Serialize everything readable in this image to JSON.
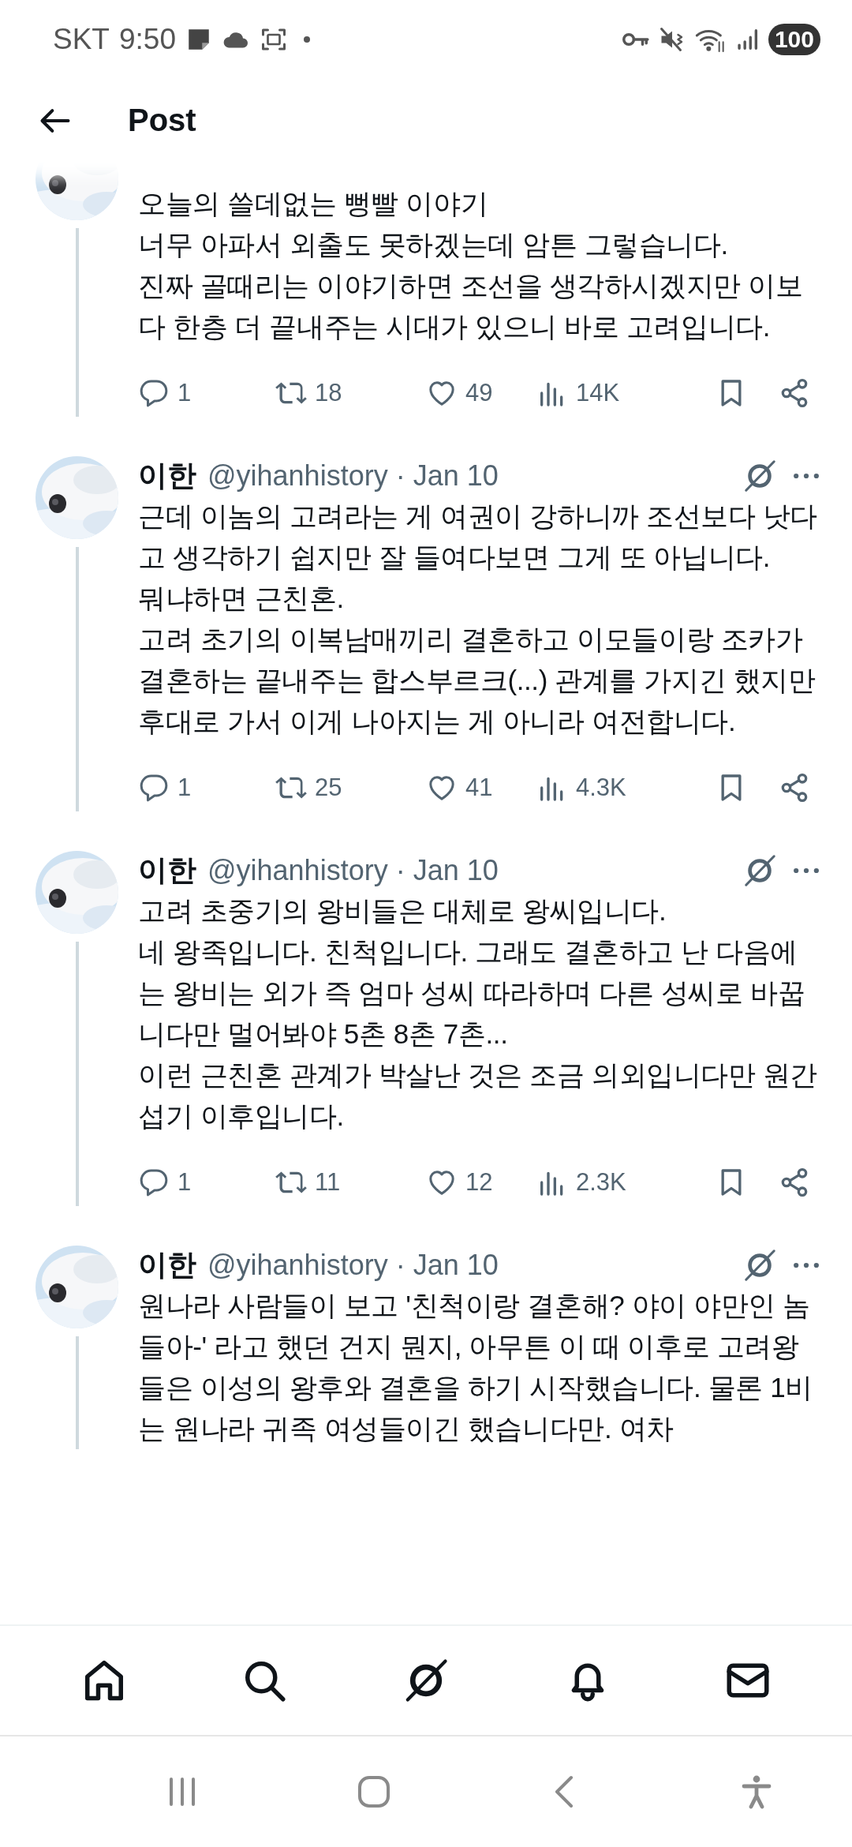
{
  "status_bar": {
    "carrier": "SKT",
    "time": "9:50",
    "battery": "100"
  },
  "header": {
    "title": "Post"
  },
  "tweets": [
    {
      "lines": [
        "오늘의 쓸데없는 뻥빨 이야기",
        "너무 아파서 외출도 못하겠는데 암튼 그렇습니다.",
        "진짜 골때리는 이야기하면 조선을 생각하시겠지만 이보다 한층 더 끝내주는 시대가 있으니 바로 고려입니다."
      ],
      "stats": {
        "replies": "1",
        "reposts": "18",
        "likes": "49",
        "views": "14K"
      }
    },
    {
      "name": "이한",
      "meta": "@yihanhistory · Jan 10",
      "lines": [
        "근데 이놈의 고려라는 게 여권이 강하니까 조선보다 낫다고 생각하기 쉽지만 잘 들여다보면 그게 또 아닙니다.",
        "뭐냐하면 근친혼.",
        "고려 초기의 이복남매끼리 결혼하고 이모들이랑 조카가 결혼하는 끝내주는 합스부르크(...) 관계를 가지긴 했지만 후대로 가서 이게 나아지는 게 아니라 여전합니다."
      ],
      "stats": {
        "replies": "1",
        "reposts": "25",
        "likes": "41",
        "views": "4.3K"
      }
    },
    {
      "name": "이한",
      "meta": "@yihanhistory · Jan 10",
      "lines": [
        "고려 초중기의 왕비들은 대체로 왕씨입니다.",
        "네 왕족입니다. 친척입니다. 그래도 결혼하고 난 다음에는 왕비는 외가 즉 엄마 성씨 따라하며 다른 성씨로 바꿉니다만 멀어봐야 5촌 8촌 7촌...",
        "이런 근친혼 관계가 박살난 것은 조금 의외입니다만 원간섭기 이후입니다."
      ],
      "stats": {
        "replies": "1",
        "reposts": "11",
        "likes": "12",
        "views": "2.3K"
      }
    },
    {
      "name": "이한",
      "meta": "@yihanhistory · Jan 10",
      "lines": [
        "원나라 사람들이 보고 '친척이랑 결혼해? 야이 야만인 놈들아-' 라고 했던 건지 뭔지, 아무튼 이 때 이후로 고려왕들은 이성의 왕후와 결혼을 하기 시작했습니다. 물론 1비는 원나라 귀족 여성들이긴 했습니다만. 여차"
      ]
    }
  ]
}
